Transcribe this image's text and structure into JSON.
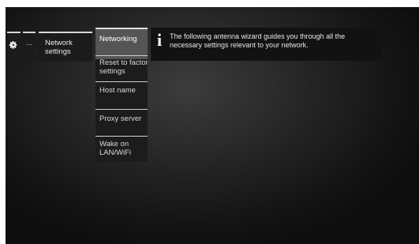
{
  "breadcrumb": {
    "settings_icon": "gear-icon",
    "ellipsis": "...",
    "network_settings": "Network settings"
  },
  "menu": {
    "items": [
      {
        "label": "Networking",
        "selected": true
      },
      {
        "label": "Reset to factory settings",
        "selected": false
      },
      {
        "label": "Host name",
        "selected": false
      },
      {
        "label": "Proxy server",
        "selected": false
      },
      {
        "label": "Wake on LAN/WiFi",
        "selected": false
      }
    ]
  },
  "info": {
    "icon": "info-icon",
    "text": "The following antenna wizard guides you through all the necessary settings relevant to your network."
  },
  "colors": {
    "background": "#1a1a1a",
    "selected_item": "#555555",
    "text": "#e8e8e8"
  }
}
